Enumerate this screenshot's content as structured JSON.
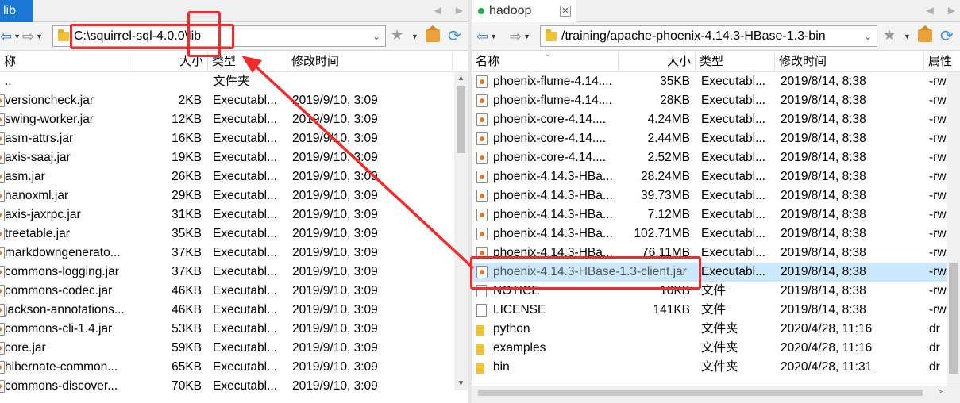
{
  "left_panel": {
    "tab_label": "lib",
    "address": "C:\\squirrel-sql-4.0.0\\lib",
    "columns": [
      "称",
      "大小",
      "类型",
      "修改时间"
    ],
    "rows": [
      {
        "name": "..",
        "size": "",
        "type": "文件夹",
        "modified": "",
        "icon": "parent"
      },
      {
        "name": "versioncheck.jar",
        "size": "2KB",
        "type": "Executabl...",
        "modified": "2019/9/10, 3:09",
        "icon": "jar-icon"
      },
      {
        "name": "swing-worker.jar",
        "size": "12KB",
        "type": "Executabl...",
        "modified": "2019/9/10, 3:09",
        "icon": "jar-icon"
      },
      {
        "name": "asm-attrs.jar",
        "size": "16KB",
        "type": "Executabl...",
        "modified": "2019/9/10, 3:09",
        "icon": "jar-icon"
      },
      {
        "name": "axis-saaj.jar",
        "size": "19KB",
        "type": "Executabl...",
        "modified": "2019/9/10, 3:09",
        "icon": "jar-icon"
      },
      {
        "name": "asm.jar",
        "size": "26KB",
        "type": "Executabl...",
        "modified": "2019/9/10, 3:09",
        "icon": "jar-icon"
      },
      {
        "name": "nanoxml.jar",
        "size": "29KB",
        "type": "Executabl...",
        "modified": "2019/9/10, 3:09",
        "icon": "jar-icon"
      },
      {
        "name": "axis-jaxrpc.jar",
        "size": "31KB",
        "type": "Executabl...",
        "modified": "2019/9/10, 3:09",
        "icon": "jar-icon"
      },
      {
        "name": "treetable.jar",
        "size": "35KB",
        "type": "Executabl...",
        "modified": "2019/9/10, 3:09",
        "icon": "jar-icon"
      },
      {
        "name": "markdowngenerato...",
        "size": "37KB",
        "type": "Executabl...",
        "modified": "2019/9/10, 3:09",
        "icon": "jar-icon"
      },
      {
        "name": "commons-logging.jar",
        "size": "37KB",
        "type": "Executabl...",
        "modified": "2019/9/10, 3:09",
        "icon": "jar-icon"
      },
      {
        "name": "commons-codec.jar",
        "size": "46KB",
        "type": "Executabl...",
        "modified": "2019/9/10, 3:09",
        "icon": "jar-icon"
      },
      {
        "name": "jackson-annotations...",
        "size": "46KB",
        "type": "Executabl...",
        "modified": "2019/9/10, 3:09",
        "icon": "jar-icon"
      },
      {
        "name": "commons-cli-1.4.jar",
        "size": "53KB",
        "type": "Executabl...",
        "modified": "2019/9/10, 3:09",
        "icon": "jar-icon"
      },
      {
        "name": "core.jar",
        "size": "59KB",
        "type": "Executabl...",
        "modified": "2019/9/10, 3:09",
        "icon": "jar-icon"
      },
      {
        "name": "hibernate-common...",
        "size": "65KB",
        "type": "Executabl...",
        "modified": "2019/9/10, 3:09",
        "icon": "jar-icon"
      },
      {
        "name": "commons-discover...",
        "size": "70KB",
        "type": "Executabl...",
        "modified": "2019/9/10, 3:09",
        "icon": "jar-icon"
      }
    ]
  },
  "right_panel": {
    "tab_label": "hadoop",
    "address": "/training/apache-phoenix-4.14.3-HBase-1.3-bin",
    "columns": [
      "名称",
      "大小",
      "类型",
      "修改时间",
      "属性"
    ],
    "rows": [
      {
        "name": "phoenix-flume-4.14....",
        "size": "35KB",
        "type": "Executabl...",
        "modified": "2019/8/14, 8:38",
        "attr": "-rw",
        "icon": "jar-icon"
      },
      {
        "name": "phoenix-flume-4.14....",
        "size": "28KB",
        "type": "Executabl...",
        "modified": "2019/8/14, 8:38",
        "attr": "-rw",
        "icon": "jar-icon"
      },
      {
        "name": "phoenix-core-4.14....",
        "size": "4.24MB",
        "type": "Executabl...",
        "modified": "2019/8/14, 8:38",
        "attr": "-rw",
        "icon": "jar-icon"
      },
      {
        "name": "phoenix-core-4.14....",
        "size": "2.44MB",
        "type": "Executabl...",
        "modified": "2019/8/14, 8:38",
        "attr": "-rw",
        "icon": "jar-icon"
      },
      {
        "name": "phoenix-core-4.14....",
        "size": "2.52MB",
        "type": "Executabl...",
        "modified": "2019/8/14, 8:38",
        "attr": "-rw",
        "icon": "jar-icon"
      },
      {
        "name": "phoenix-4.14.3-HBa...",
        "size": "28.24MB",
        "type": "Executabl...",
        "modified": "2019/8/14, 8:38",
        "attr": "-rw",
        "icon": "jar-icon"
      },
      {
        "name": "phoenix-4.14.3-HBa...",
        "size": "39.73MB",
        "type": "Executabl...",
        "modified": "2019/8/14, 8:38",
        "attr": "-rw",
        "icon": "jar-icon"
      },
      {
        "name": "phoenix-4.14.3-HBa...",
        "size": "7.12MB",
        "type": "Executabl...",
        "modified": "2019/8/14, 8:38",
        "attr": "-rw",
        "icon": "jar-icon"
      },
      {
        "name": "phoenix-4.14.3-HBa...",
        "size": "102.71MB",
        "type": "Executabl...",
        "modified": "2019/8/14, 8:38",
        "attr": "-rw",
        "icon": "jar-icon"
      },
      {
        "name": "phoenix-4.14.3-HBa...",
        "size": "76.11MB",
        "type": "Executabl...",
        "modified": "2019/8/14, 8:38",
        "attr": "-rw",
        "icon": "jar-icon"
      },
      {
        "name": "phoenix-4.14.3-HBase-1.3-client.jar",
        "size": "",
        "type": "Executabl...",
        "modified": "2019/8/14, 8:38",
        "attr": "-rw",
        "icon": "jar-icon",
        "selected": true
      },
      {
        "name": "NOTICE",
        "size": "10KB",
        "type": "文件",
        "modified": "2019/8/14, 8:38",
        "attr": "-rw",
        "icon": "file-icon"
      },
      {
        "name": "LICENSE",
        "size": "141KB",
        "type": "文件",
        "modified": "2019/8/14, 8:38",
        "attr": "-rw",
        "icon": "file-icon"
      },
      {
        "name": "python",
        "size": "",
        "type": "文件夹",
        "modified": "2020/4/28, 11:16",
        "attr": "dr",
        "icon": "folder-icon"
      },
      {
        "name": "examples",
        "size": "",
        "type": "文件夹",
        "modified": "2020/4/28, 11:16",
        "attr": "dr",
        "icon": "folder-icon"
      },
      {
        "name": "bin",
        "size": "",
        "type": "文件夹",
        "modified": "2020/4/28, 11:31",
        "attr": "dr",
        "icon": "folder-icon"
      }
    ]
  },
  "colors": {
    "active_tab": "#1a78d4",
    "selected_row": "#cce8ff",
    "annotation": "#f52a2a",
    "connected_dot": "#1fb04b"
  }
}
